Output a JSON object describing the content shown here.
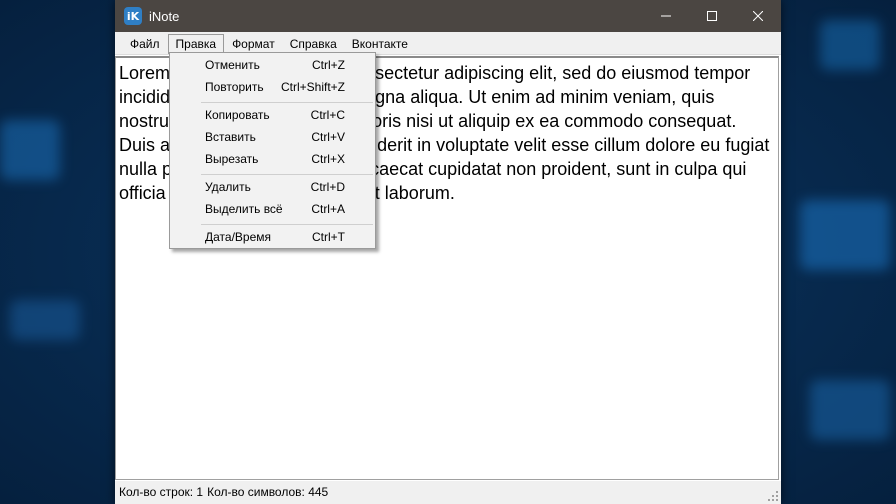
{
  "window": {
    "title": "iNote",
    "icon_text": "iK"
  },
  "menubar": {
    "items": [
      "Файл",
      "Правка",
      "Формат",
      "Справка",
      "Вконтакте"
    ]
  },
  "edit_menu": {
    "items": [
      {
        "label": "Отменить",
        "shortcut": "Ctrl+Z"
      },
      {
        "label": "Повторить",
        "shortcut": "Ctrl+Shift+Z"
      },
      {
        "label": "Копировать",
        "shortcut": "Ctrl+C"
      },
      {
        "label": "Вставить",
        "shortcut": "Ctrl+V"
      },
      {
        "label": "Вырезать",
        "shortcut": "Ctrl+X"
      },
      {
        "label": "Удалить",
        "shortcut": "Ctrl+D"
      },
      {
        "label": "Выделить всё",
        "shortcut": "Ctrl+A"
      },
      {
        "label": "Дата/Время",
        "shortcut": "Ctrl+T"
      }
    ]
  },
  "editor": {
    "text": "Lorem ipsum dolor sit amet, consectetur adipiscing elit, sed do eiusmod tempor incididunt ut labore et dolore magna aliqua. Ut enim ad minim veniam, quis nostrud exercitation ullamco laboris nisi ut aliquip ex ea commodo consequat. Duis aute irure dolor in reprehenderit in voluptate velit esse cillum dolore eu fugiat nulla pariatur. Excepteur sint occaecat cupidatat non proident, sunt in culpa qui officia deserunt mollit anim id est laborum."
  },
  "status": {
    "lines": "Кол-во строк: 1",
    "chars": "Кол-во символов: 445"
  },
  "colors": {
    "titlebar": "#4b4642",
    "accent": "#2f7fc5",
    "background": "#082c52"
  }
}
